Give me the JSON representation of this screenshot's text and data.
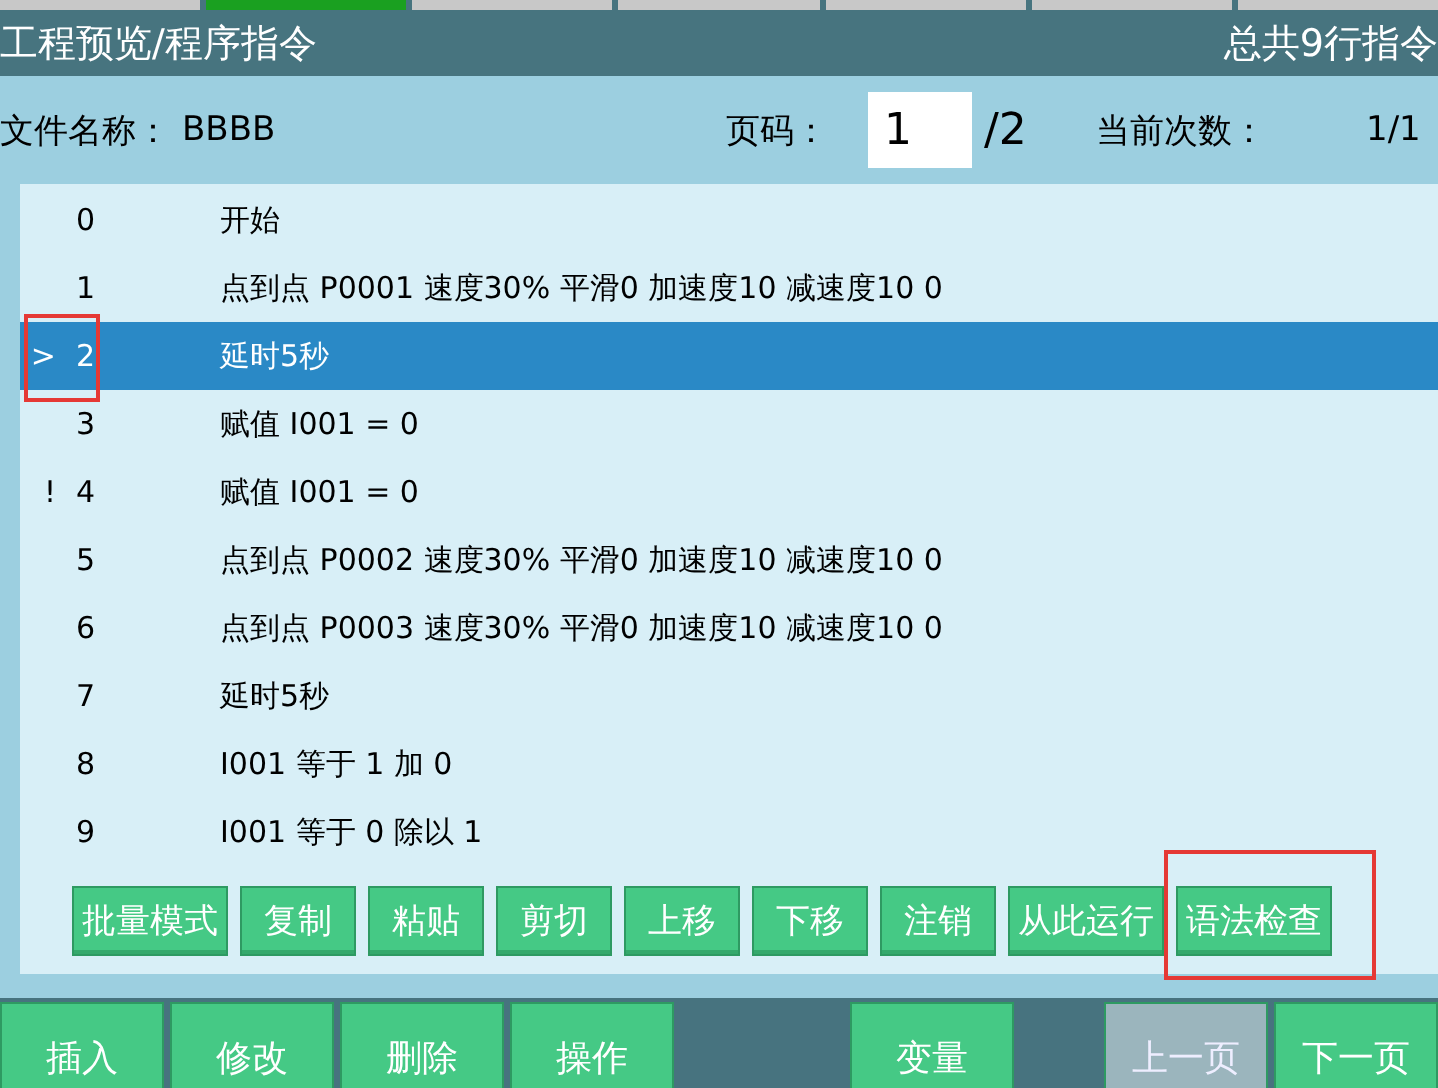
{
  "title_bar": {
    "title": "工程预览/程序指令",
    "summary": "总共9行指令"
  },
  "info": {
    "file_label": "文件名称：",
    "file_name": "BBBB",
    "page_label": "页码：",
    "page_value": "1",
    "page_total": "/2",
    "count_label": "当前次数：",
    "count_value": "1/1"
  },
  "rows": [
    {
      "marker": "",
      "number": "0",
      "text": "开始",
      "selected": false,
      "highlighted": false
    },
    {
      "marker": "",
      "number": "1",
      "text": "点到点 P0001 速度30% 平滑0 加速度10 减速度10 0",
      "selected": false,
      "highlighted": false
    },
    {
      "marker": ">",
      "number": "2",
      "text": "延时5秒",
      "selected": true,
      "highlighted": true
    },
    {
      "marker": "",
      "number": "3",
      "text": "赋值 I001 = 0",
      "selected": false,
      "highlighted": false
    },
    {
      "marker": "!",
      "number": "4",
      "text": "赋值 I001 = 0",
      "selected": false,
      "highlighted": false
    },
    {
      "marker": "",
      "number": "5",
      "text": "点到点 P0002 速度30% 平滑0 加速度10 减速度10 0",
      "selected": false,
      "highlighted": false
    },
    {
      "marker": "",
      "number": "6",
      "text": "点到点 P0003 速度30% 平滑0 加速度10 减速度10 0",
      "selected": false,
      "highlighted": false
    },
    {
      "marker": "",
      "number": "7",
      "text": "延时5秒",
      "selected": false,
      "highlighted": false
    },
    {
      "marker": "",
      "number": "8",
      "text": "I001 等于 1 加 0",
      "selected": false,
      "highlighted": false
    },
    {
      "marker": "",
      "number": "9",
      "text": "I001 等于 0 除以 1",
      "selected": false,
      "highlighted": false
    }
  ],
  "tools": [
    {
      "label": "批量模式",
      "highlighted": false
    },
    {
      "label": "复制",
      "highlighted": false
    },
    {
      "label": "粘贴",
      "highlighted": false
    },
    {
      "label": "剪切",
      "highlighted": false
    },
    {
      "label": "上移",
      "highlighted": false
    },
    {
      "label": "下移",
      "highlighted": false
    },
    {
      "label": "注销",
      "highlighted": false
    },
    {
      "label": "从此运行",
      "highlighted": false
    },
    {
      "label": "语法检查",
      "highlighted": true
    }
  ],
  "bottom_buttons": [
    {
      "label": "插入",
      "disabled": false,
      "gap_before": false
    },
    {
      "label": "修改",
      "disabled": false,
      "gap_before": false
    },
    {
      "label": "删除",
      "disabled": false,
      "gap_before": false
    },
    {
      "label": "操作",
      "disabled": false,
      "gap_before": false
    },
    {
      "label": "变量",
      "disabled": false,
      "gap_before": true
    },
    {
      "label": "上一页",
      "disabled": true,
      "gap_before": true
    },
    {
      "label": "下一页",
      "disabled": false,
      "gap_before": false
    }
  ]
}
